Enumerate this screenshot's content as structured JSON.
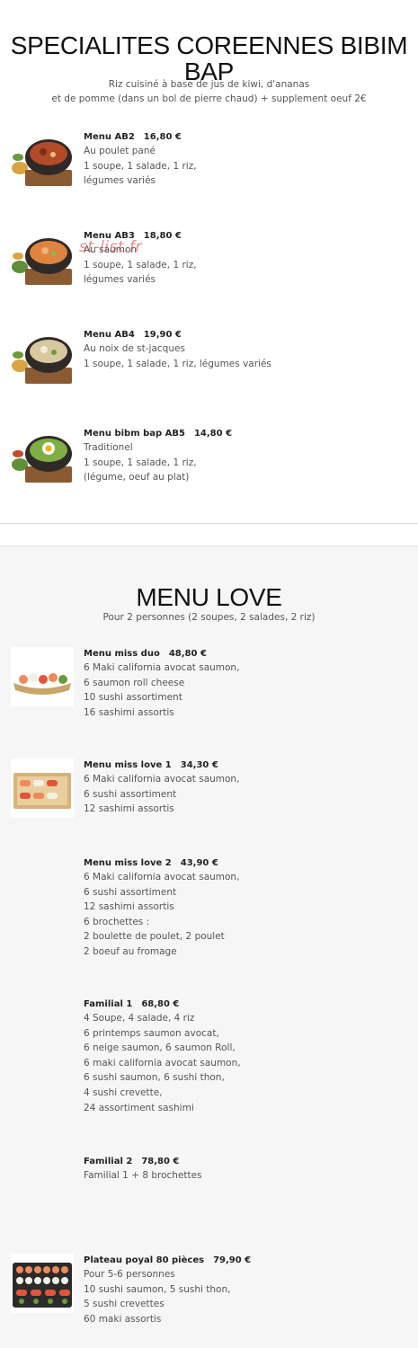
{
  "section1": {
    "title": "SPECIALITES COREENNES BIBIM BAP",
    "subtitle_line1": "Riz cuisiné à base de jus de kiwi, d'ananas",
    "subtitle_line2": "et de pomme (dans un bol de pierre chaud) + supplement oeuf 2€",
    "items": [
      {
        "name": "Menu AB2",
        "price": "16,80 €",
        "lines": [
          "Au poulet pané",
          "1 soupe, 1 salade, 1 riz,",
          "légumes variés"
        ]
      },
      {
        "name": "Menu AB3",
        "price": "18,80 €",
        "lines": [
          "Au saumon",
          "1 soupe, 1 salade, 1 riz,",
          "légumes variés"
        ]
      },
      {
        "name": "Menu AB4",
        "price": "19,90 €",
        "lines": [
          "Au noix de st-jacques",
          "1 soupe, 1 salade, 1 riz, légumes variés"
        ]
      },
      {
        "name": "Menu bibm bap AB5",
        "price": "14,80 €",
        "lines": [
          "Traditionel",
          "1 soupe, 1 salade, 1 riz,",
          "(légume, oeuf au plat)"
        ]
      }
    ]
  },
  "watermark": "st-list.fr",
  "section2": {
    "title": "MENU LOVE",
    "subtitle": "Pour 2 personnes (2 soupes, 2 salades, 2 riz)",
    "items": [
      {
        "name": "Menu miss duo",
        "price": "48,80 €",
        "lines": [
          "6 Maki california avocat saumon,",
          "6 saumon roll cheese",
          "10 sushi assortiment",
          "16 sashimi assortis"
        ]
      },
      {
        "name": "Menu miss love 1",
        "price": "34,30 €",
        "lines": [
          "6 Maki california avocat saumon,",
          "6 sushi assortiment",
          "12 sashimi assortis"
        ]
      },
      {
        "name": "Menu miss love 2",
        "price": "43,90 €",
        "lines": [
          "6 Maki california avocat saumon,",
          "6 sushi assortiment",
          "12 sashimi assortis",
          "6 brochettes :",
          "2 boulette de poulet, 2 poulet",
          "2 boeuf au fromage"
        ]
      },
      {
        "name": "Familial 1",
        "price": "68,80 €",
        "lines": [
          "4 Soupe, 4 salade, 4 riz",
          "6 printemps saumon avocat,",
          "6 neige saumon, 6 saumon Roll,",
          "6 maki california avocat saumon,",
          "6 sushi saumon, 6 sushi thon,",
          "4 sushi crevette,",
          "24 assortiment sashimi"
        ]
      },
      {
        "name": "Familial 2",
        "price": "78,80 €",
        "lines": [
          "Familial 1 + 8 brochettes"
        ]
      },
      {
        "name": "Plateau poyal 80 pièces",
        "price": "79,90 €",
        "lines": [
          "Pour 5-6 personnes",
          "10 sushi saumon, 5 sushi thon,",
          "5 sushi crevettes",
          "60 maki assortis"
        ]
      }
    ]
  }
}
